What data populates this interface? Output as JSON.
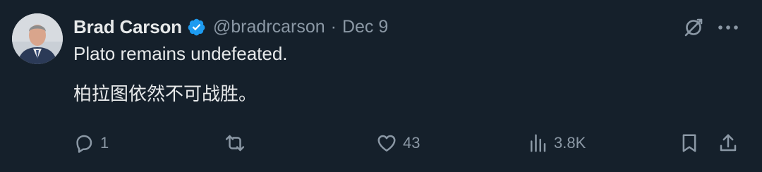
{
  "colors": {
    "background": "#15202b",
    "text_primary": "#e7e9ea",
    "text_secondary": "#8b98a5",
    "verified_badge": "#1d9bf0"
  },
  "tweet": {
    "author_name": "Brad Carson",
    "handle": "@bradrcarson",
    "separator": "·",
    "date": "Dec 9",
    "verified_icon": "verified-badge-icon",
    "body_english": "Plato remains undefeated.",
    "body_chinese": "柏拉图依然不可战胜。"
  },
  "header_actions": {
    "grok_icon": "grok-icon",
    "more_icon": "more-options-icon"
  },
  "actions": {
    "reply": {
      "icon": "reply-icon",
      "count": "1"
    },
    "retweet": {
      "icon": "retweet-icon",
      "count": ""
    },
    "like": {
      "icon": "like-icon",
      "count": "43"
    },
    "views": {
      "icon": "views-icon",
      "count": "3.8K"
    },
    "bookmark": {
      "icon": "bookmark-icon"
    },
    "share": {
      "icon": "share-icon"
    }
  }
}
